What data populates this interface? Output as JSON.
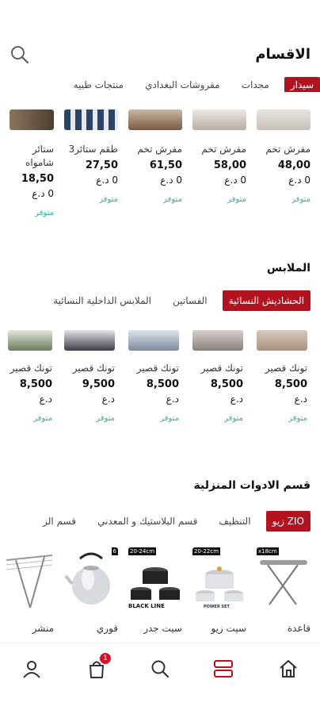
{
  "header": {
    "title": "الاقسام",
    "search_icon": "search-icon"
  },
  "sec1": {
    "tabs": [
      {
        "label": "سيدار",
        "active": true
      },
      {
        "label": "مجدات",
        "active": false
      },
      {
        "label": "مفروشات البغدادي",
        "active": false
      },
      {
        "label": "منتجات طبيه",
        "active": false
      }
    ],
    "items": [
      {
        "name": "مفرش تخم",
        "price": "48,00",
        "currency": "0 د.ع",
        "avail": "متوفر",
        "color": "#d8d4d0"
      },
      {
        "name": "مفرش تخم",
        "price": "58,00",
        "currency": "0 د.ع",
        "avail": "متوفر",
        "color": "#cfc6bd"
      },
      {
        "name": "مفرش تخم",
        "price": "61,50",
        "currency": "0 د.ع",
        "avail": "متوفر",
        "color": "#8c6d55"
      },
      {
        "name": "طقم ستائر3",
        "price": "27,50",
        "currency": "0 د.ع",
        "avail": "متوفر",
        "color": "#2f4c6b"
      },
      {
        "name": "ستائر شامواه",
        "price": "18,50",
        "currency": "0 د.ع",
        "avail": "متوفر",
        "color": "#6e5a45"
      }
    ]
  },
  "sec2": {
    "title": "الملابس",
    "tabs": [
      {
        "label": "الحشاديش النسائية",
        "active": true
      },
      {
        "label": "الفساتين",
        "active": false
      },
      {
        "label": "الملابس الداخلية النسائية",
        "active": false
      }
    ],
    "items": [
      {
        "name": "تونك قصير",
        "price": "8,500",
        "currency": "د.ع",
        "avail": "متوفر",
        "color": "#b39a88"
      },
      {
        "name": "تونك قصير",
        "price": "8,500",
        "currency": "د.ع",
        "avail": "متوفر",
        "color": "#8a8080"
      },
      {
        "name": "تونك قصير",
        "price": "8,500",
        "currency": "د.ع",
        "avail": "متوفر",
        "color": "#7d8a96"
      },
      {
        "name": "تونك قصير",
        "price": "9,500",
        "currency": "د.ع",
        "avail": "متوفر",
        "color": "#3b3a44"
      },
      {
        "name": "تونك قصير",
        "price": "8,500",
        "currency": "د.ع",
        "avail": "متوفر",
        "color": "#6b7d5e"
      }
    ]
  },
  "sec3": {
    "title": "قسم الادوات المنزلية",
    "tabs": [
      {
        "label": "ZIO زيو",
        "active": true
      },
      {
        "label": "التنظيف",
        "active": false
      },
      {
        "label": "قسم البلاستيك و المعدني",
        "active": false
      },
      {
        "label": "قسم الز",
        "active": false
      }
    ],
    "items": [
      {
        "name": "قاعدة",
        "tag": "x18cm"
      },
      {
        "name": "سيت زيو",
        "tag": "20-22cm",
        "sub": "POWER SET"
      },
      {
        "name": "سيت جدر",
        "tag": "20-24cm",
        "sub": "BLACK LINE"
      },
      {
        "name": "قوري",
        "tag": "6"
      },
      {
        "name": "منشر",
        "tag": ""
      }
    ]
  },
  "nav": {
    "cart_count": "1",
    "items": [
      "home-icon",
      "categories-icon",
      "search-icon",
      "cart-icon",
      "profile-icon"
    ]
  }
}
